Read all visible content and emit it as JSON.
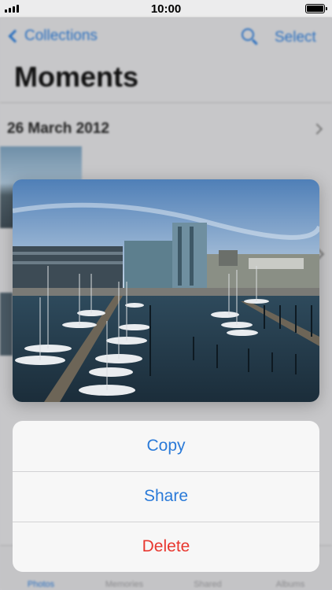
{
  "status_bar": {
    "time": "10:00"
  },
  "app": {
    "back_label": "Collections",
    "select_label": "Select",
    "title": "Moments",
    "section_date": "26 March 2012"
  },
  "tab_bar": {
    "tabs": [
      {
        "label": "Photos",
        "active": true
      },
      {
        "label": "Memories",
        "active": false
      },
      {
        "label": "Shared",
        "active": false
      },
      {
        "label": "Albums",
        "active": false
      }
    ]
  },
  "preview": {
    "icon": "photo-preview",
    "subject": "harbour marina with sailboats and office buildings"
  },
  "action_sheet": {
    "copy_label": "Copy",
    "share_label": "Share",
    "delete_label": "Delete"
  },
  "colors": {
    "accent": "#2a7ad8",
    "destructive": "#e8372f"
  }
}
